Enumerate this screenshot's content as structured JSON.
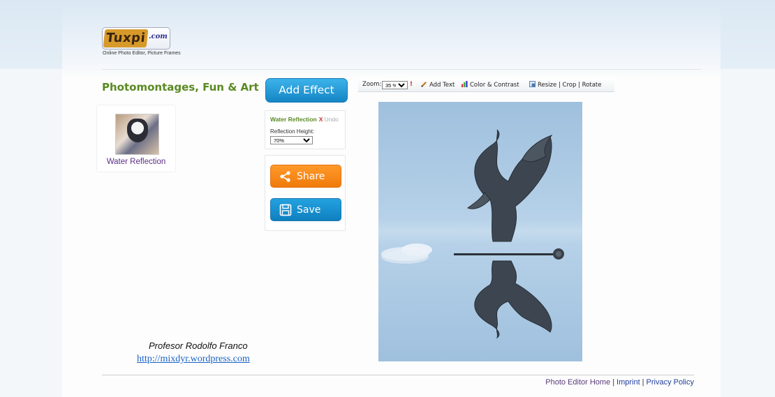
{
  "header": {
    "logo_text": "Tuxpi",
    "logo_suffix": ".com",
    "tagline": "Online Photo Editor, Picture Frames"
  },
  "sidebar": {
    "section_title": "Photomontages, Fun & Art",
    "effects": [
      {
        "label": "Water Reflection",
        "icon": "cat-thumbnail"
      }
    ]
  },
  "credit": {
    "name": "Profesor Rodolfo Franco",
    "link": "http://mixdyr.wordpress.com"
  },
  "controls": {
    "add_effect_label": "Add Effect",
    "reflection_panel": {
      "title": "Water Reflection",
      "close_label": "X",
      "undo_label": "Undo",
      "height_label": "Reflection Height:",
      "height_value": "70%"
    },
    "share_label": "Share",
    "save_label": "Save"
  },
  "toolbar": {
    "zoom_label": "Zoom:",
    "zoom_value": "35 %",
    "zoom_warning": "!",
    "add_text_label": "Add Text",
    "color_contrast_label": "Color & Contrast",
    "resize_label": "Resize",
    "crop_label": "Crop",
    "rotate_label": "Rotate",
    "separator": "|"
  },
  "footer": {
    "home_label": "Photo Editor Home",
    "imprint_label": "Imprint",
    "privacy_label": "Privacy Policy",
    "separator": "|"
  },
  "colors": {
    "accent_green": "#5a8a22",
    "button_blue": "#1585c4",
    "button_orange": "#f07a0c",
    "link_blue": "#1a62c4"
  }
}
